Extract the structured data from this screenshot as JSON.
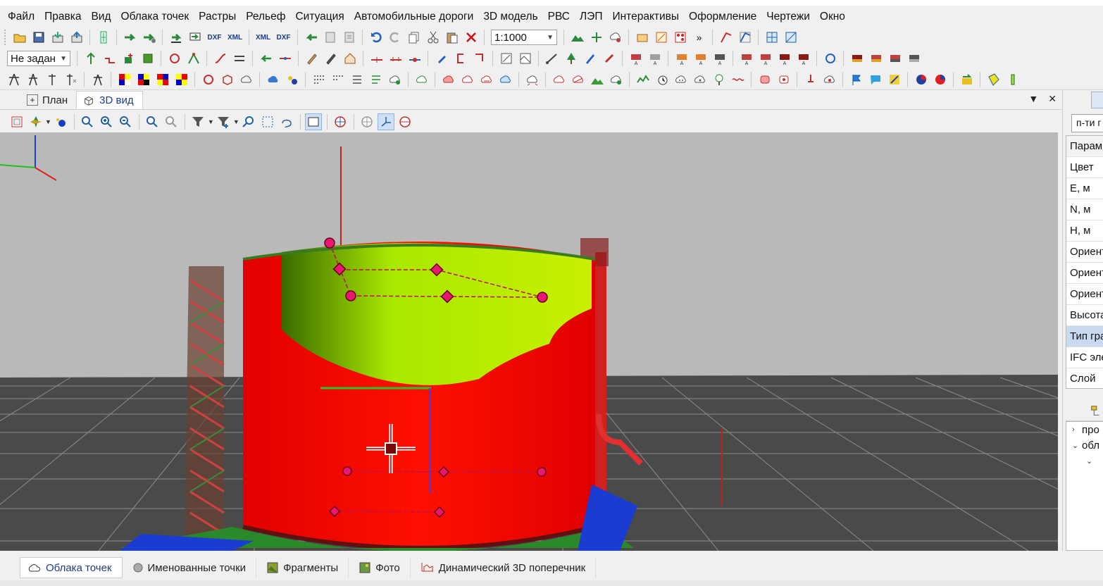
{
  "menu": [
    "Файл",
    "Правка",
    "Вид",
    "Облака точек",
    "Растры",
    "Рельеф",
    "Ситуация",
    "Автомобильные дороги",
    "3D модель",
    "РВС",
    "ЛЭП",
    "Интерактивы",
    "Оформление",
    "Чертежи",
    "Окно"
  ],
  "toolbar": {
    "scale_value": "1:1000",
    "dxf_label": "DXF",
    "xml_label": "XML",
    "layer_value": "Не задан",
    "overflow_label": "»"
  },
  "doc_tabs": [
    {
      "label": "План",
      "icon": "plan-icon"
    },
    {
      "label": "3D вид",
      "icon": "cube-icon"
    }
  ],
  "tab_controls": {
    "menu": "▼",
    "close": "✕"
  },
  "right_panel": {
    "search_value": "п-ти г",
    "properties": [
      "Парам",
      "Цвет",
      "E, м",
      "N, м",
      "H, м",
      "Ориент",
      "Ориент",
      "Ориент",
      "Высота",
      "Тип гра",
      "IFC эле",
      "Слой"
    ],
    "selected_index": 9,
    "tree": [
      {
        "toggle": "›",
        "label": "про"
      },
      {
        "toggle": "⌄",
        "label": "обл"
      },
      {
        "toggle": "⌄",
        "label": ""
      }
    ]
  },
  "bottom_tabs": [
    {
      "label": "Облака точек",
      "icon": "cloud-icon"
    },
    {
      "label": "Именованные точки",
      "icon": "point-icon"
    },
    {
      "label": "Фрагменты",
      "icon": "fragment-icon"
    },
    {
      "label": "Фото",
      "icon": "photo-icon"
    },
    {
      "label": "Динамический 3D поперечник",
      "icon": "crosssection-icon"
    }
  ],
  "colors": {
    "tank_red": "#ff0000",
    "tank_green": "#a8f000",
    "marker_pink": "#e8186e",
    "ground": "#4a4a4a",
    "sky": "#b9b9b9",
    "accent_blue": "#1a3c8c"
  }
}
